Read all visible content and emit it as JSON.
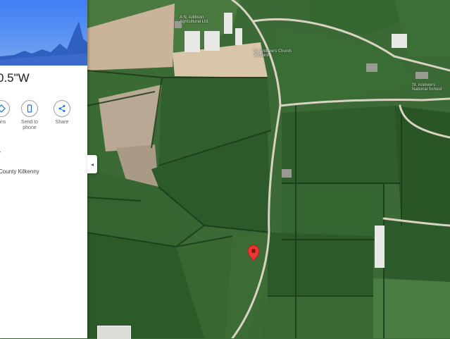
{
  "panel": {
    "coordinates": "0.5\"W",
    "actions": [
      {
        "icon": "directions-icon",
        "label": "ions"
      },
      {
        "icon": "phone-icon",
        "label": "Send to\nphone"
      },
      {
        "icon": "share-icon",
        "label": "Share"
      }
    ],
    "address": "County Kilkenny"
  },
  "map_labels": {
    "place_1": "A N. Addison\nAgricultural Ltd.",
    "place_2": "St. Andrew's Church\nJerpoint",
    "place_3": "St. Andrew's\nNational School"
  },
  "colors": {
    "pin": "#e53935",
    "field_dark": "#2f5a2c",
    "field_mid": "#3f7238",
    "field_light": "#4d8442",
    "road": "#d8d3c2"
  }
}
